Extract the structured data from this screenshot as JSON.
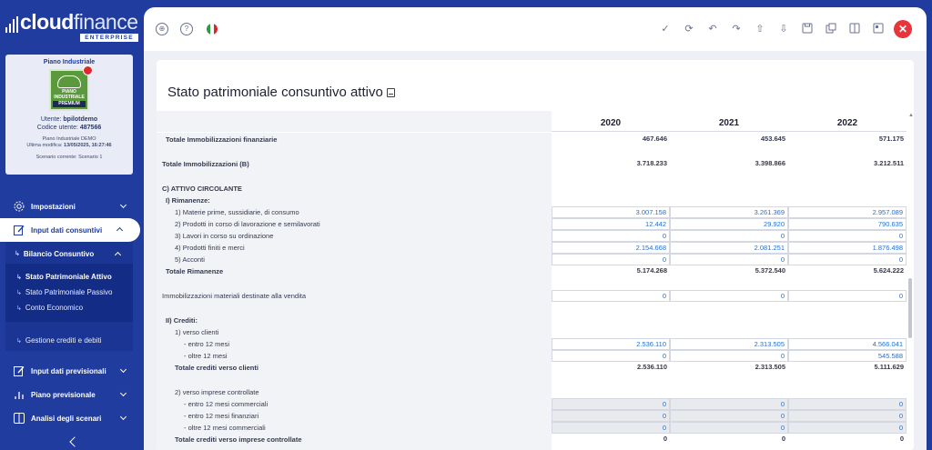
{
  "brand": {
    "name_bold": "cloud",
    "name_light": "finance",
    "edition": "ENTERPRISE"
  },
  "profile": {
    "title": "Piano Industriale",
    "badge": {
      "line1": "PIANO",
      "line2": "INDUSTRIALE",
      "line3": "PREMIUM"
    },
    "user_label": "Utente:",
    "user": "bpilotdemo",
    "code_label": "Codice utente:",
    "code": "487566",
    "plan_name": "Piano Industriale DEMO",
    "last_mod_label": "Ultima modifica:",
    "last_mod": "13/05/2025, 16:27:46",
    "scenario": "Scenario corrente: Scenario 1"
  },
  "menu": {
    "impostazioni": "Impostazioni",
    "input_consuntivi": "Input dati consuntivi",
    "bilancio": "Bilancio Consuntivo",
    "sp_attivo": "Stato Patrimoniale Attivo",
    "sp_passivo": "Stato Patrimoniale Passivo",
    "conto_economico": "Conto Economico",
    "gestione_crediti": "Gestione crediti e debiti",
    "input_previsionali": "Input dati previsionali",
    "piano_previsionale": "Piano previsionale",
    "analisi_scenari": "Analisi degli scenari"
  },
  "icons": {
    "topbar_left": [
      "lifebuoy-icon",
      "help-icon",
      "italy-flag-icon"
    ],
    "topbar_right": [
      "check-icon",
      "refresh-icon",
      "undo-icon",
      "redo-icon",
      "upload-icon",
      "download-icon",
      "save-icon",
      "copy-icon",
      "columns-icon",
      "panel-icon",
      "close-icon"
    ]
  },
  "colors": {
    "brand_blue": "#1f3c9e",
    "value_blue": "#2a6fc9",
    "close_red": "#e8353c"
  },
  "page": {
    "title": "Stato patrimoniale consuntivo attivo"
  },
  "table": {
    "years": [
      "2020",
      "2021",
      "2022"
    ],
    "rows": [
      {
        "label": "Totale Immobilizzazioni finanziarie",
        "indent": 10,
        "type": "bold total",
        "values": [
          "467.646",
          "453.645",
          "571.175"
        ]
      },
      {
        "label": "Totale Immobilizzazioni (B)",
        "indent": 6,
        "type": "bold total",
        "values": [
          "3.718.233",
          "3.398.866",
          "3.212.511"
        ],
        "gap": 14
      },
      {
        "label": "C) ATTIVO CIRCOLANTE",
        "indent": 6,
        "type": "bold",
        "values": [
          "",
          "",
          ""
        ],
        "gap": 14
      },
      {
        "label": "I) Rimanenze:",
        "indent": 10,
        "type": "bold",
        "values": [
          "",
          "",
          ""
        ]
      },
      {
        "label": "1) Materie prime, sussidiarie, di consumo",
        "indent": 20,
        "type": "input",
        "values": [
          "3.007.158",
          "3.261.369",
          "2.957.089"
        ]
      },
      {
        "label": "2) Prodotti in corso di lavorazione e semilavorati",
        "indent": 20,
        "type": "input",
        "values": [
          "12.442",
          "29.920",
          "790.635"
        ]
      },
      {
        "label": "3) Lavori in corso su ordinazione",
        "indent": 20,
        "type": "input",
        "values": [
          "0",
          "0",
          "0"
        ]
      },
      {
        "label": "4) Prodotti finiti e merci",
        "indent": 20,
        "type": "input",
        "values": [
          "2.154.668",
          "2.081.251",
          "1.876.498"
        ]
      },
      {
        "label": "5) Acconti",
        "indent": 20,
        "type": "input",
        "values": [
          "0",
          "0",
          "0"
        ]
      },
      {
        "label": "Totale Rimanenze",
        "indent": 10,
        "type": "bold total",
        "values": [
          "5.174.268",
          "5.372.540",
          "5.624.222"
        ]
      },
      {
        "label": "Immobilizzazioni materiali destinate alla vendita",
        "indent": 6,
        "type": "input",
        "values": [
          "0",
          "0",
          "0"
        ],
        "gap": 14
      },
      {
        "label": "II) Crediti:",
        "indent": 10,
        "type": "bold",
        "values": [
          "",
          "",
          ""
        ],
        "gap": 14
      },
      {
        "label": "1) verso clienti",
        "indent": 20,
        "type": "plain",
        "values": [
          "",
          "",
          ""
        ]
      },
      {
        "label": "- entro 12 mesi",
        "indent": 30,
        "type": "input",
        "values": [
          "2.536.110",
          "2.313.505",
          "4.566.041"
        ]
      },
      {
        "label": "- oltre 12 mesi",
        "indent": 30,
        "type": "input",
        "values": [
          "0",
          "0",
          "545.588"
        ]
      },
      {
        "label": "Totale crediti verso clienti",
        "indent": 20,
        "type": "bold total",
        "values": [
          "2.536.110",
          "2.313.505",
          "5.111.629"
        ]
      },
      {
        "label": "2) verso imprese controllate",
        "indent": 20,
        "type": "plain",
        "values": [
          "",
          "",
          ""
        ],
        "gap": 14
      },
      {
        "label": "- entro 12 mesi commerciali",
        "indent": 30,
        "type": "inputgray",
        "values": [
          "0",
          "0",
          "0"
        ]
      },
      {
        "label": "- entro 12 mesi finanziari",
        "indent": 30,
        "type": "inputgray",
        "values": [
          "0",
          "0",
          "0"
        ]
      },
      {
        "label": "- oltre 12 mesi commerciali",
        "indent": 30,
        "type": "inputgray",
        "values": [
          "0",
          "0",
          "0"
        ]
      },
      {
        "label": "Totale crediti verso imprese controllate",
        "indent": 20,
        "type": "bold total",
        "values": [
          "0",
          "0",
          "0"
        ]
      }
    ]
  }
}
